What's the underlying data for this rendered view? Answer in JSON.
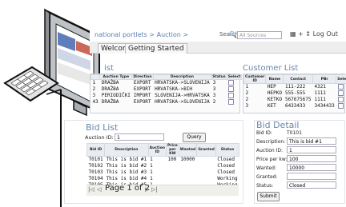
{
  "header": {
    "breadcrumb": "national portlets > Auction >",
    "search_label": "Search",
    "search_placeholder": "All Sources",
    "right_menu": "▦ + ↕ Log Out"
  },
  "tabs": [
    {
      "label": "Welcome"
    },
    {
      "label": "Getting Started"
    }
  ],
  "auction_list": {
    "title": "ist",
    "columns": [
      "",
      "Auction Type",
      "Direction",
      "Description",
      "Status",
      "Select"
    ],
    "rows": [
      [
        "1",
        "DRAŽBA",
        "EXPORT",
        "HRVATSKA->SLOVENIJA",
        "3"
      ],
      [
        "2",
        "DRAŽBA",
        "EXPORT",
        "HRVATSKA->BIH",
        "3"
      ],
      [
        "3",
        "PERIODIČKI",
        "IMPORT",
        "SLOVENIJA->HRVATSKA",
        "3"
      ],
      [
        "43",
        "DRAŽBA",
        "EXPORT",
        "HRVATSKA->SLOVENIJA",
        "2"
      ]
    ]
  },
  "customer_list": {
    "title": "Customer List",
    "columns": [
      "Customer ID",
      "Name",
      "Contact",
      "PBr",
      "Select"
    ],
    "rows": [
      [
        "1",
        "HEP",
        "111-222",
        "4321"
      ],
      [
        "2",
        "HEPKO",
        "555-555",
        "1111"
      ],
      [
        "2",
        "KETKO",
        "567675675",
        "1111"
      ],
      [
        "3",
        "KET",
        "6433433",
        "3434433"
      ]
    ]
  },
  "bid_list": {
    "title": "Bid List",
    "auction_id_label": "Auction ID:",
    "auction_id_value": "1",
    "query_button": "Query",
    "columns": [
      "Bid ID",
      "Description",
      "Auction ID",
      "Price per KW",
      "Wanted",
      "Granted",
      "Status"
    ],
    "rows": [
      [
        "T0101",
        "This is bid #1",
        "1",
        "100",
        "10000",
        "",
        "Closed"
      ],
      [
        "T0102",
        "This is bid #2",
        "1",
        "",
        "",
        "",
        "Closed"
      ],
      [
        "T0103",
        "This is bid #3",
        "1",
        "",
        "",
        "",
        "Closed"
      ],
      [
        "T0104",
        "This is bid #4",
        "1",
        "",
        "",
        "",
        "Working"
      ],
      [
        "T0105",
        "This is bid #5",
        "1",
        "",
        "",
        "",
        "Working"
      ]
    ],
    "pager": "Page 1 of 2"
  },
  "bid_detail": {
    "title": "Bid Detail",
    "fields": [
      {
        "label": "Bid ID:",
        "value": "T0101"
      },
      {
        "label": "Description:",
        "value": "This is bid #1"
      },
      {
        "label": "Auction ID:",
        "value": "1"
      },
      {
        "label": "Price per kw:",
        "value": "100"
      },
      {
        "label": "Wanted:",
        "value": "10000"
      },
      {
        "label": "Granted:",
        "value": ""
      },
      {
        "label": "Status:",
        "value": "Closed"
      }
    ],
    "submit_button": "Submit"
  },
  "colors": {
    "accent": "#6a86a9",
    "panel_border": "#c7cfd9"
  },
  "icons": [
    "computer-monitor-icon",
    "keyboard-icon",
    "search-icon",
    "pager-first-icon",
    "pager-prev-icon",
    "pager-next-icon",
    "pager-last-icon"
  ]
}
